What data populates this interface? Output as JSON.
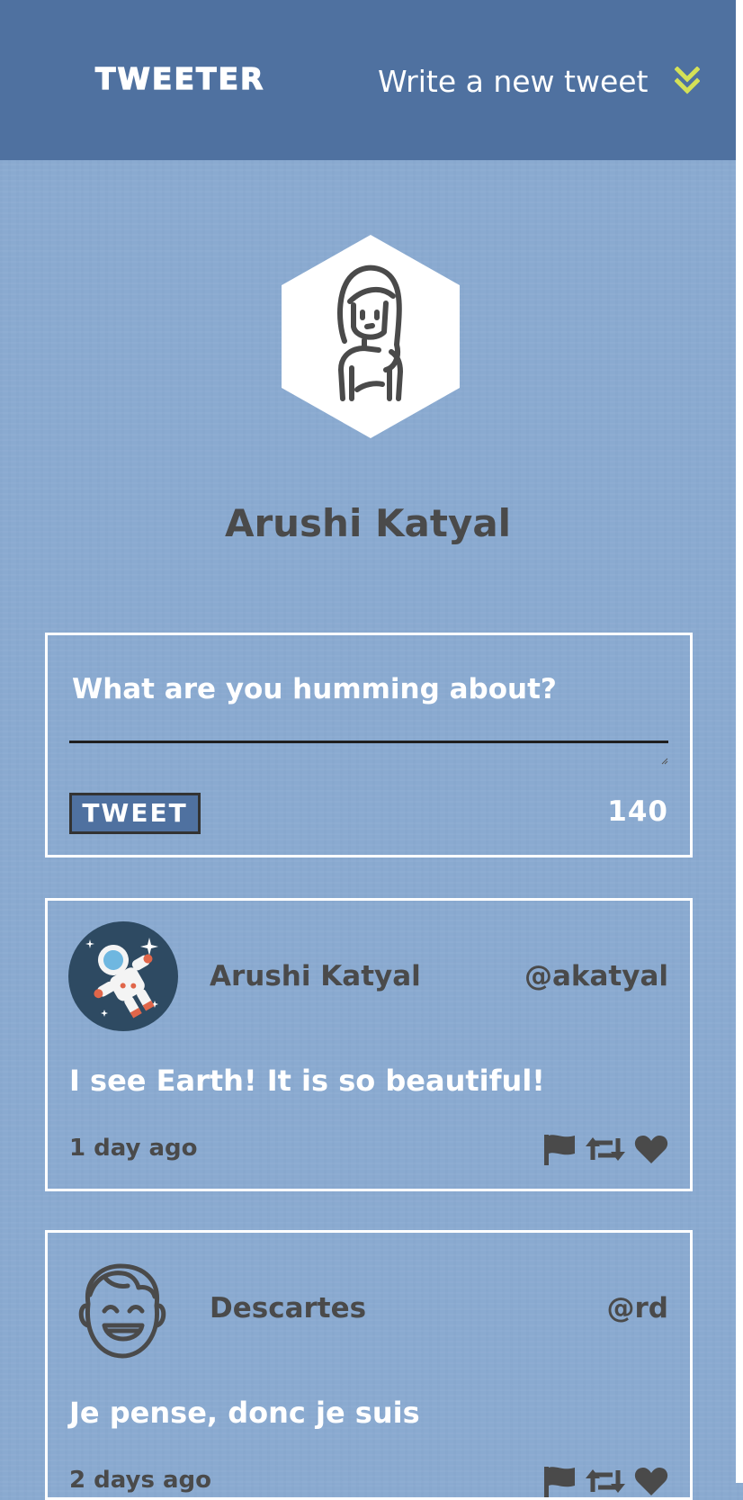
{
  "nav": {
    "brand": "TWEETER",
    "compose_toggle_label": "Write a new tweet",
    "accent_color": "#d4e157",
    "background_color": "#4f71a0"
  },
  "profile": {
    "name": "Arushi Katyal",
    "avatar_icon": "woman-portrait-icon"
  },
  "compose": {
    "placeholder": "What are you humming about?",
    "value": "",
    "button_label": "TWEET",
    "char_count": "140"
  },
  "tweets": [
    {
      "author": "Arushi Katyal",
      "handle": "@akatyal",
      "avatar_icon": "astronaut-icon",
      "content": "I see Earth! It is so beautiful!",
      "time": "1 day ago",
      "actions": [
        "flag-icon",
        "retweet-icon",
        "heart-icon"
      ]
    },
    {
      "author": "Descartes",
      "handle": "@rd",
      "avatar_icon": "smiling-face-icon",
      "content": "Je pense, donc je suis",
      "time": "2 days ago",
      "actions": [
        "flag-icon",
        "retweet-icon",
        "heart-icon"
      ]
    }
  ],
  "colors": {
    "page_background": "#8aaad0",
    "text_dark": "#4a4a4a",
    "text_light": "#ffffff"
  }
}
